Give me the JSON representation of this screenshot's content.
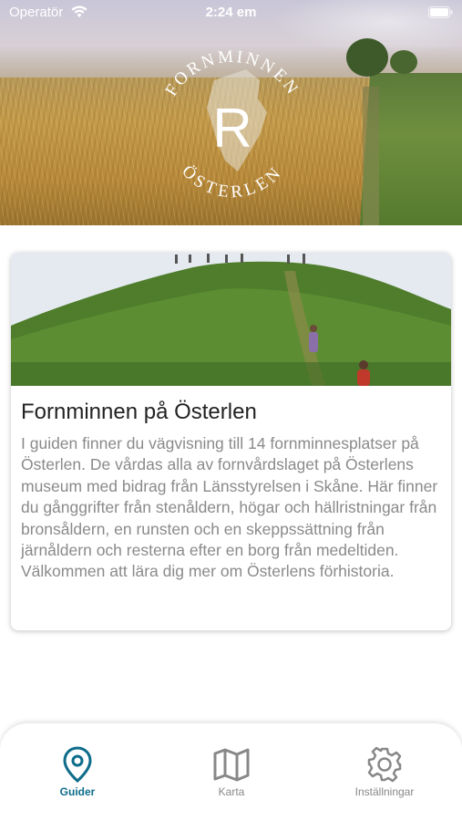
{
  "status_bar": {
    "carrier": "Operatör",
    "time": "2:24 em"
  },
  "hero": {
    "logo_text_top": "FORNMINNEN",
    "logo_text_bottom": "ÖSTERLEN",
    "logo_letter": "R"
  },
  "guide": {
    "title": "Fornminnen på Österlen",
    "description": "I guiden finner du vägvisning till 14 fornminnesplatser på Österlen. De vårdas alla av fornvårdslaget på Österlens museum med bidrag från Länsstyrelsen i Skåne. Här finner du gånggrifter från stenåldern, högar och hällristningar från bronsåldern, en runsten och en skeppssättning från järnåldern och resterna efter en borg från medeltiden. Välkommen att lära dig mer om Österlens förhistoria."
  },
  "tabbar": {
    "tabs": [
      {
        "label": "Guider",
        "icon": "map-pin-icon",
        "active": true
      },
      {
        "label": "Karta",
        "icon": "map-icon",
        "active": false
      },
      {
        "label": "Inställningar",
        "icon": "gear-icon",
        "active": false
      }
    ]
  },
  "colors": {
    "accent": "#0e6c8a",
    "inactive": "#888888",
    "body_text": "#8a8a8a",
    "title_text": "#222222"
  }
}
